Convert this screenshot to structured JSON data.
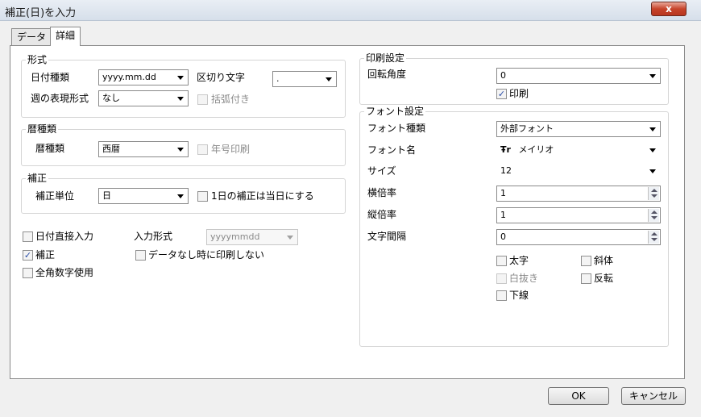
{
  "window": {
    "title": "補正(日)を入力",
    "close_glyph": "x"
  },
  "tabs": [
    {
      "label": "データ"
    },
    {
      "label": "詳細"
    }
  ],
  "format_group": {
    "legend": "形式",
    "date_type_label": "日付種類",
    "date_type_value": "yyyy.mm.dd",
    "separator_label": "区切り文字",
    "separator_value": ".",
    "week_format_label": "週の表現形式",
    "week_format_value": "なし",
    "bracket_label": "括弧付き"
  },
  "calendar_group": {
    "legend": "暦種類",
    "calendar_label": "暦種類",
    "calendar_value": "西暦",
    "era_print_label": "年号印刷"
  },
  "correction_group": {
    "legend": "補正",
    "unit_label": "補正単位",
    "unit_value": "日",
    "same_day_label": "1日の補正は当日にする"
  },
  "options": {
    "direct_input_label": "日付直接入力",
    "input_format_label": "入力形式",
    "input_format_value": "yyyymmdd",
    "correction_label": "補正",
    "no_print_label": "データなし時に印刷しない",
    "fullwidth_label": "全角数字使用",
    "check_glyph": "✓"
  },
  "print_group": {
    "legend": "印刷設定",
    "rotation_label": "回転角度",
    "rotation_value": "0",
    "print_label": "印刷"
  },
  "font_group": {
    "legend": "フォント設定",
    "font_type_label": "フォント種類",
    "font_type_value": "外部フォント",
    "font_name_label": "フォント名",
    "font_name_value": "メイリオ",
    "font_icon_glyph": "Ŧr",
    "size_label": "サイズ",
    "size_value": "12",
    "h_scale_label": "横倍率",
    "h_scale_value": "1",
    "v_scale_label": "縦倍率",
    "v_scale_value": "1",
    "spacing_label": "文字間隔",
    "spacing_value": "0",
    "bold_label": "太字",
    "italic_label": "斜体",
    "outline_label": "白抜き",
    "reverse_label": "反転",
    "underline_label": "下線"
  },
  "buttons": {
    "ok": "OK",
    "cancel": "キャンセル"
  },
  "colors": {
    "accent": "#2b4ea8",
    "close": "#c7442b"
  }
}
